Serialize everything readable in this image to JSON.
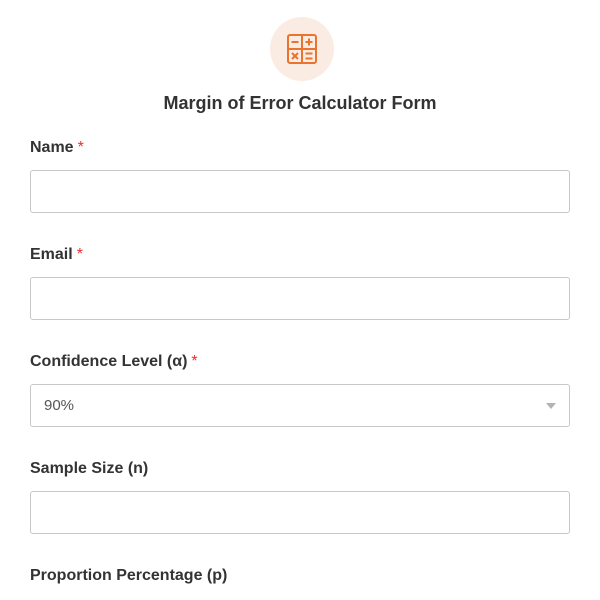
{
  "form": {
    "title": "Margin of Error Calculator Form",
    "logo_icon": "calculator-icon",
    "accent_color": "#e8742f",
    "required_marker": "*"
  },
  "fields": {
    "name": {
      "label": "Name",
      "required": true,
      "value": ""
    },
    "email": {
      "label": "Email",
      "required": true,
      "value": ""
    },
    "confidence_level": {
      "label": "Confidence Level (α)",
      "required": true,
      "selected": "90%"
    },
    "sample_size": {
      "label": "Sample Size (n)",
      "required": false,
      "value": ""
    },
    "proportion_percentage": {
      "label": "Proportion Percentage (p)",
      "required": false
    }
  }
}
